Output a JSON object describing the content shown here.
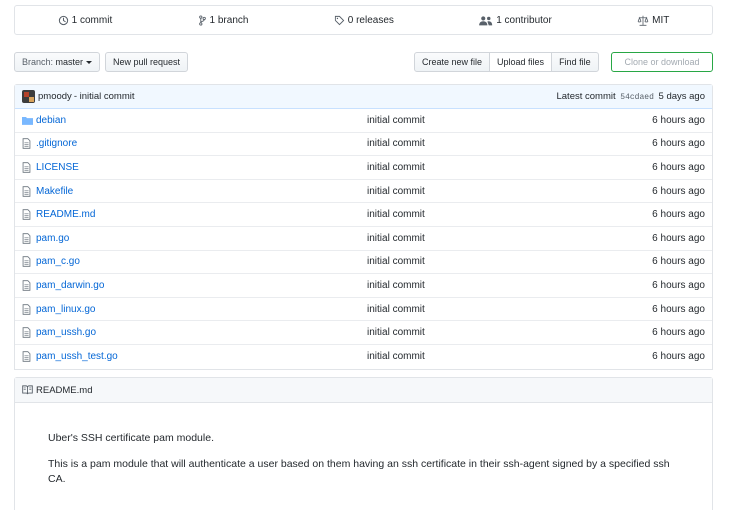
{
  "summary": {
    "commits": "1 commit",
    "branches": "1 branch",
    "releases": "0 releases",
    "contributors": "1 contributor",
    "license": "MIT"
  },
  "toolbar": {
    "branch_prefix": "Branch:",
    "branch_name": "master",
    "new_pull_request": "New pull request",
    "create_new_file": "Create new file",
    "upload_files": "Upload files",
    "find_file": "Find file",
    "clone_or_download": "Clone or download"
  },
  "latest_commit": {
    "author": "pmoody",
    "message": "- initial commit",
    "label": "Latest commit",
    "sha": "54cdaed",
    "age": "5 days ago"
  },
  "files": [
    {
      "name": "debian",
      "type": "folder",
      "message": "initial commit",
      "age": "6 hours ago"
    },
    {
      "name": ".gitignore",
      "type": "file",
      "message": "initial commit",
      "age": "6 hours ago"
    },
    {
      "name": "LICENSE",
      "type": "file",
      "message": "initial commit",
      "age": "6 hours ago"
    },
    {
      "name": "Makefile",
      "type": "file",
      "message": "initial commit",
      "age": "6 hours ago"
    },
    {
      "name": "README.md",
      "type": "file",
      "message": "initial commit",
      "age": "6 hours ago"
    },
    {
      "name": "pam.go",
      "type": "file",
      "message": "initial commit",
      "age": "6 hours ago"
    },
    {
      "name": "pam_c.go",
      "type": "file",
      "message": "initial commit",
      "age": "6 hours ago"
    },
    {
      "name": "pam_darwin.go",
      "type": "file",
      "message": "initial commit",
      "age": "6 hours ago"
    },
    {
      "name": "pam_linux.go",
      "type": "file",
      "message": "initial commit",
      "age": "6 hours ago"
    },
    {
      "name": "pam_ussh.go",
      "type": "file",
      "message": "initial commit",
      "age": "6 hours ago"
    },
    {
      "name": "pam_ussh_test.go",
      "type": "file",
      "message": "initial commit",
      "age": "6 hours ago"
    }
  ],
  "readme": {
    "title": "README.md",
    "paragraphs": [
      "Uber's SSH certificate pam module.",
      "This is a pam module that will authenticate a user based on them having an ssh certificate in their ssh-agent signed by a specified ssh CA."
    ]
  },
  "colors": {
    "link": "#0366d6",
    "clone_border": "#28a745",
    "commit_bar_bg": "#f1f8ff",
    "folder_icon": "#79b8ff"
  }
}
